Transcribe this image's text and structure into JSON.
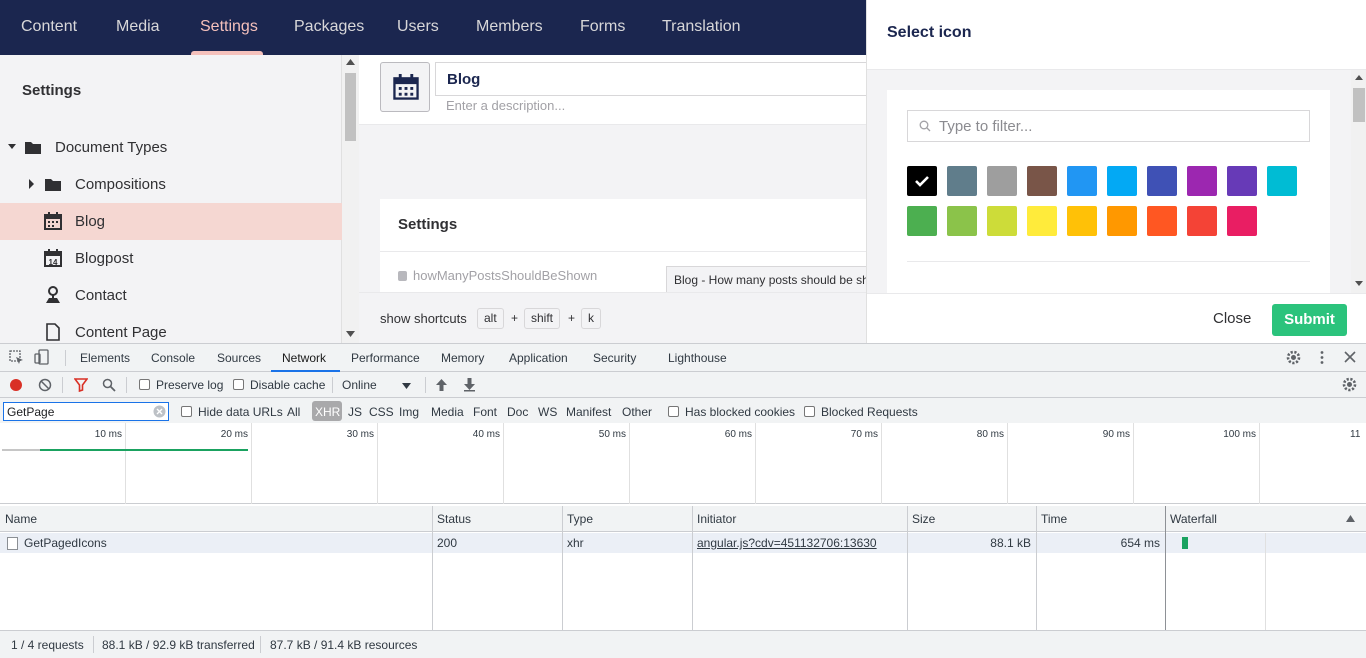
{
  "nav": {
    "items": [
      "Content",
      "Media",
      "Settings",
      "Packages",
      "Users",
      "Members",
      "Forms",
      "Translation"
    ],
    "active": "Settings"
  },
  "tree": {
    "title": "Settings",
    "items": [
      {
        "label": "Document Types",
        "icon": "folder-icon"
      },
      {
        "label": "Compositions",
        "icon": "folder-icon"
      },
      {
        "label": "Blog",
        "icon": "calendar-icon"
      },
      {
        "label": "Blogpost",
        "icon": "calendar-14-icon"
      },
      {
        "label": "Contact",
        "icon": "map-pin-icon"
      },
      {
        "label": "Content Page",
        "icon": "document-icon"
      }
    ]
  },
  "editor": {
    "name_value": "Blog",
    "description_placeholder": "Enter a description...",
    "settings_title": "Settings",
    "property_alias": "howManyPostsShouldBeShown",
    "property_label": "Blog - How many posts should be shown",
    "shortcuts_label": "show shortcuts",
    "keys": [
      "alt",
      "shift",
      "k"
    ]
  },
  "overlay": {
    "title": "Select icon",
    "filter_placeholder": "Type to filter...",
    "colors_row1": [
      "#000000",
      "#607d8b",
      "#9e9e9e",
      "#795548",
      "#2196f3",
      "#03a9f4",
      "#3f51b5",
      "#9c27b0",
      "#673ab7",
      "#00bcd4"
    ],
    "colors_row2": [
      "#4caf50",
      "#8bc34a",
      "#cddc39",
      "#ffeb3b",
      "#ffc107",
      "#ff9800",
      "#ff5722",
      "#f44336",
      "#e91e63"
    ],
    "close_label": "Close",
    "submit_label": "Submit"
  },
  "devtools": {
    "tabs": [
      "Elements",
      "Console",
      "Sources",
      "Network",
      "Performance",
      "Memory",
      "Application",
      "Security",
      "Lighthouse"
    ],
    "active_tab": "Network",
    "preserve_log": "Preserve log",
    "disable_cache": "Disable cache",
    "throttle": "Online",
    "filter_value": "GetPage",
    "hide_data_urls": "Hide data URLs",
    "types": [
      "All",
      "XHR",
      "JS",
      "CSS",
      "Img",
      "Media",
      "Font",
      "Doc",
      "WS",
      "Manifest",
      "Other"
    ],
    "active_type": "XHR",
    "has_blocked_cookies": "Has blocked cookies",
    "blocked_requests": "Blocked Requests",
    "timeline_ticks": [
      "10 ms",
      "20 ms",
      "30 ms",
      "40 ms",
      "50 ms",
      "60 ms",
      "70 ms",
      "80 ms",
      "90 ms",
      "100 ms",
      "11"
    ],
    "columns": [
      "Name",
      "Status",
      "Type",
      "Initiator",
      "Size",
      "Time",
      "Waterfall"
    ],
    "row": {
      "name": "GetPagedIcons",
      "status": "200",
      "type": "xhr",
      "initiator": "angular.js?cdv=451132706:13630",
      "size": "88.1 kB",
      "time": "654 ms"
    },
    "status": {
      "requests": "1 / 4 requests",
      "transferred": "88.1 kB / 92.9 kB transferred",
      "resources": "87.7 kB / 91.4 kB resources"
    }
  }
}
